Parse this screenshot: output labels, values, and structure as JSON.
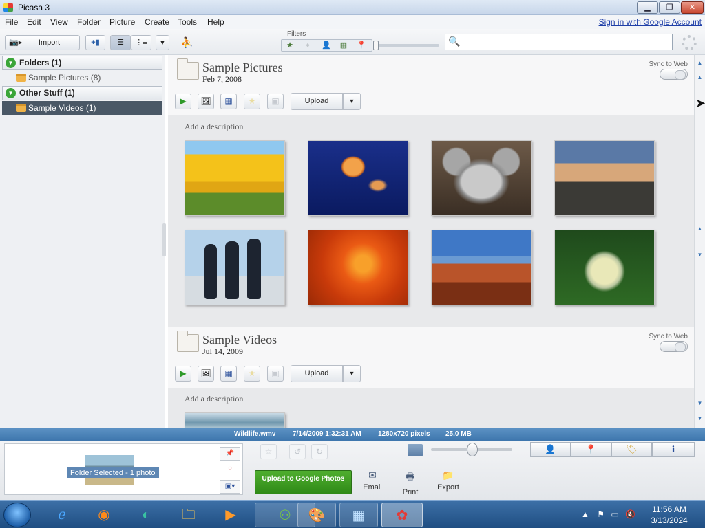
{
  "window": {
    "title": "Picasa 3"
  },
  "menu": {
    "items": [
      "File",
      "Edit",
      "View",
      "Folder",
      "Picture",
      "Create",
      "Tools",
      "Help"
    ],
    "sign_in": "Sign in with Google Account"
  },
  "toolbar": {
    "import_label": "Import",
    "filters_label": "Filters",
    "search_value": ""
  },
  "sidebar": {
    "sections": [
      {
        "title": "Folders (1)",
        "items": [
          {
            "label": "Sample Pictures (8)",
            "selected": false
          }
        ]
      },
      {
        "title": "Other Stuff (1)",
        "items": [
          {
            "label": "Sample Videos (1)",
            "selected": true
          }
        ]
      }
    ]
  },
  "albums": [
    {
      "title": "Sample Pictures",
      "date": "Feb 7, 2008",
      "sync_label": "Sync to Web",
      "upload_label": "Upload",
      "description_placeholder": "Add a description",
      "photos": [
        "tulips",
        "jellyfish",
        "koala",
        "lighthouse",
        "penguins",
        "chrysanthemum",
        "desert",
        "hydrangeas"
      ]
    },
    {
      "title": "Sample Videos",
      "date": "Jul 14, 2009",
      "sync_label": "Sync to Web",
      "upload_label": "Upload",
      "description_placeholder": "Add a description",
      "photos": [
        "wildlife"
      ]
    }
  ],
  "status": {
    "filename": "Wildlife.wmv",
    "datetime": "7/14/2009 1:32:31 AM",
    "dimensions": "1280x720 pixels",
    "size": "25.0 MB"
  },
  "tray": {
    "label": "Folder Selected - 1 photo"
  },
  "actions": {
    "upload_google": "Upload to Google Photos",
    "email": "Email",
    "print": "Print",
    "export": "Export"
  },
  "taskbar": {
    "time": "11:56 AM",
    "date": "3/13/2024"
  },
  "colors": {
    "accent_green": "#3aa538",
    "selection": "#4a5866",
    "status_blue": "#4a82b8"
  }
}
